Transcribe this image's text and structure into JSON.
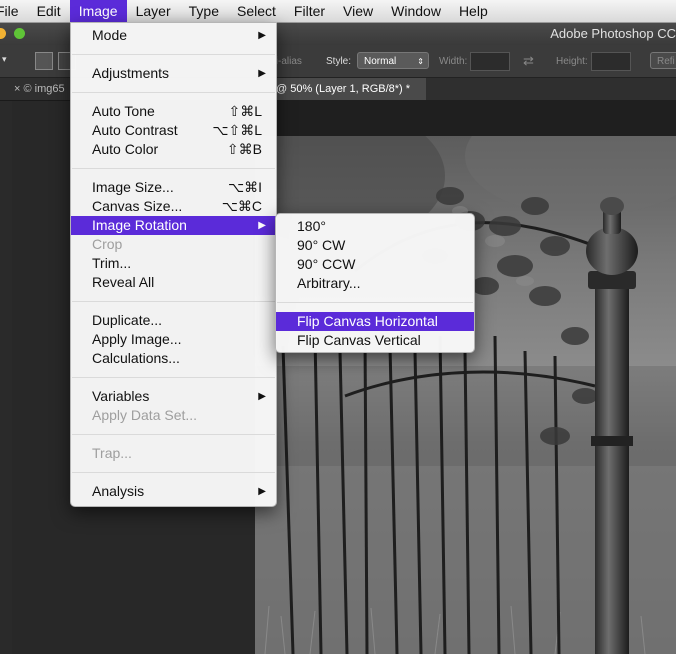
{
  "menubar": {
    "items": [
      "File",
      "Edit",
      "Image",
      "Layer",
      "Type",
      "Select",
      "Filter",
      "View",
      "Window",
      "Help"
    ],
    "active": "Image"
  },
  "titlebar": {
    "title": "Adobe Photoshop CC"
  },
  "options": {
    "anti_alias": "ti-alias",
    "style_label": "Style:",
    "style_value": "Normal",
    "width_label": "Width:",
    "height_label": "Height:",
    "refine": "Refi"
  },
  "tabs": [
    {
      "label": "× © img65"
    },
    {
      "label": "@ 50% (Layer 1, RGB/8*) *"
    }
  ],
  "image_menu": [
    {
      "label": "Mode",
      "submenu": true
    },
    {
      "sep": true
    },
    {
      "label": "Adjustments",
      "submenu": true
    },
    {
      "sep": true
    },
    {
      "label": "Auto Tone",
      "shortcut": "⇧⌘L"
    },
    {
      "label": "Auto Contrast",
      "shortcut": "⌥⇧⌘L"
    },
    {
      "label": "Auto Color",
      "shortcut": "⇧⌘B"
    },
    {
      "sep": true
    },
    {
      "label": "Image Size...",
      "shortcut": "⌥⌘I"
    },
    {
      "label": "Canvas Size...",
      "shortcut": "⌥⌘C"
    },
    {
      "label": "Image Rotation",
      "submenu": true,
      "highlighted": true
    },
    {
      "label": "Crop",
      "disabled": true
    },
    {
      "label": "Trim..."
    },
    {
      "label": "Reveal All"
    },
    {
      "sep": true
    },
    {
      "label": "Duplicate..."
    },
    {
      "label": "Apply Image..."
    },
    {
      "label": "Calculations..."
    },
    {
      "sep": true
    },
    {
      "label": "Variables",
      "submenu": true
    },
    {
      "label": "Apply Data Set...",
      "disabled": true
    },
    {
      "sep": true
    },
    {
      "label": "Trap...",
      "disabled": true
    },
    {
      "sep": true
    },
    {
      "label": "Analysis",
      "submenu": true
    }
  ],
  "rotation_menu": [
    {
      "label": "180°"
    },
    {
      "label": "90° CW"
    },
    {
      "label": "90° CCW"
    },
    {
      "label": "Arbitrary..."
    },
    {
      "sep": true
    },
    {
      "label": "Flip Canvas Horizontal",
      "highlighted": true
    },
    {
      "label": "Flip Canvas Vertical"
    }
  ],
  "colors": {
    "highlight": "#5b2bd9",
    "menu_bg": "#f7f7f7",
    "disabled_text": "#9e9e9e"
  }
}
